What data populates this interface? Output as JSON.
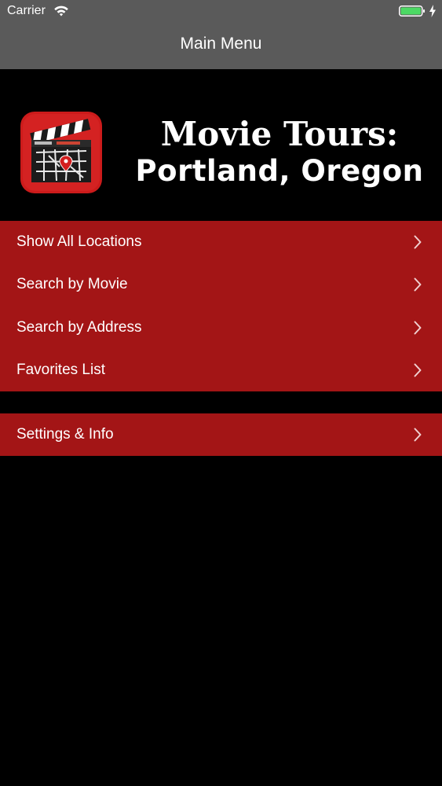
{
  "status_bar": {
    "carrier": "Carrier",
    "wifi_icon": "wifi-icon",
    "battery_icon": "battery-icon",
    "battery_color": "#4cd964"
  },
  "nav": {
    "title": "Main Menu"
  },
  "header": {
    "logo_icon": "clapperboard-map-icon",
    "title_line1": "Movie Tours:",
    "title_line2": "Portland, Oregon"
  },
  "menu": {
    "items": [
      {
        "label": "Show All Locations"
      },
      {
        "label": "Search by Movie"
      },
      {
        "label": "Search by Address"
      },
      {
        "label": "Favorites List"
      }
    ]
  },
  "settings": {
    "label": "Settings & Info"
  },
  "colors": {
    "nav_bar": "#5a5a5a",
    "menu_row": "#a31516",
    "background": "#000000"
  }
}
